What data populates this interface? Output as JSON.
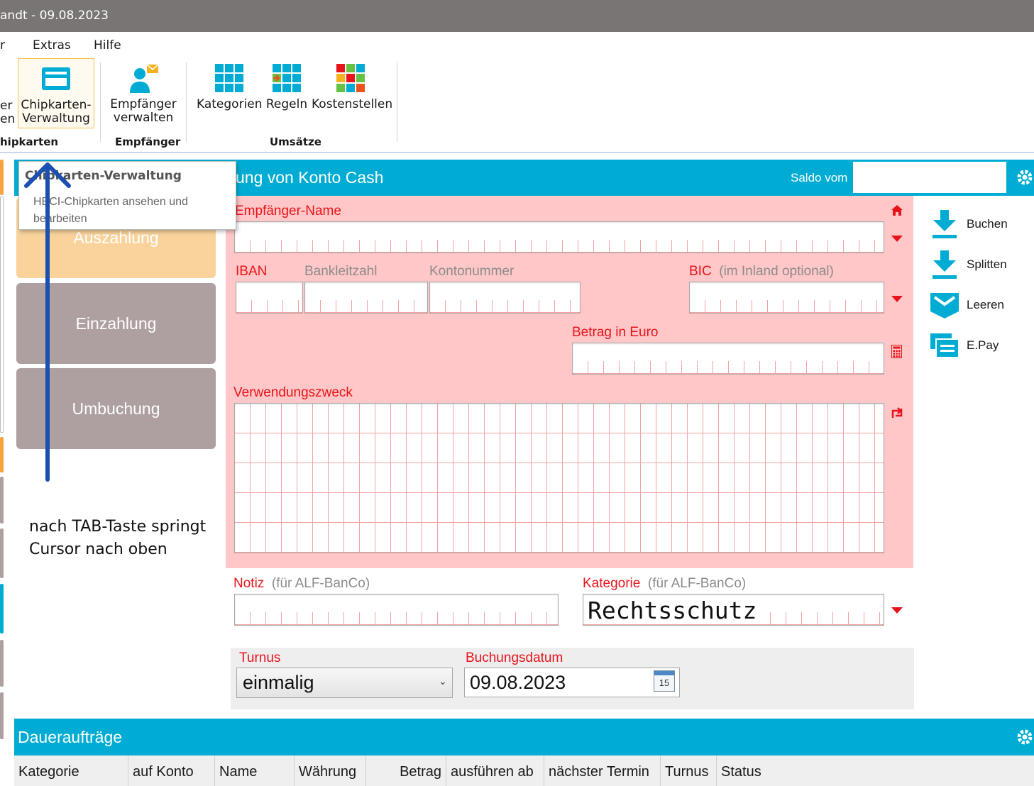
{
  "window": {
    "title": "andt  -  09.08.2023"
  },
  "menu": {
    "items": [
      {
        "label": "r"
      },
      {
        "label": "Extras"
      },
      {
        "label": "Hilfe"
      }
    ]
  },
  "ribbon": {
    "partial_button": {
      "line1": "er",
      "line2": "en"
    },
    "chip_button": {
      "line1": "Chipkarten-",
      "line2": "Verwaltung",
      "icon": "card-icon"
    },
    "chip_group": "hipkarten",
    "empf_button": {
      "line1": "Empfänger",
      "line2": "verwalten",
      "icon": "person-mail-icon"
    },
    "empf_group": "Empfänger",
    "umsaetze_buttons": [
      {
        "label": "Kategorien",
        "icon": "grid-icon"
      },
      {
        "label": "Regeln",
        "icon": "grid-arrow-icon"
      },
      {
        "label": "Kostenstellen",
        "icon": "grid-color-icon"
      }
    ],
    "umsaetze_group": "Umsätze"
  },
  "tooltip": {
    "title": "Chipkarten-Verwaltung",
    "text": "HBCI-Chipkarten ansehen und bearbeiten"
  },
  "form_header": {
    "title": "ung von Konto Cash",
    "saldo_label": "Saldo vom"
  },
  "tiles": [
    {
      "label": "Auszahlung"
    },
    {
      "label": "Einzahlung"
    },
    {
      "label": "Umbuchung"
    }
  ],
  "form": {
    "empfaenger_label": "Empfänger-Name",
    "iban_label": "IBAN",
    "blz_label": "Bankleitzahl",
    "kontonummer_label": "Kontonummer",
    "bic_label": "BIC",
    "bic_hint": "(im Inland optional)",
    "betrag_label": "Betrag in Euro",
    "verwendungszweck_label": "Verwendungszweck",
    "notiz_label": "Notiz",
    "notiz_hint": "(für ALF-BanCo)",
    "kategorie_label": "Kategorie",
    "kategorie_hint": "(für ALF-BanCo)",
    "kategorie_value": "Rechtsschutz",
    "turnus_label": "Turnus",
    "turnus_value": "einmalig",
    "buchungsdatum_label": "Buchungsdatum",
    "buchungsdatum_value": "09.08.2023",
    "calendar_day": "15"
  },
  "actions": [
    {
      "label": "Buchen",
      "icon": "download-icon"
    },
    {
      "label": "Splitten",
      "icon": "download-icon"
    },
    {
      "label": "Leeren",
      "icon": "envelope-icon"
    },
    {
      "label": "E.Pay",
      "icon": "epay-icon"
    }
  ],
  "annotation": {
    "line1": "nach TAB-Taste springt",
    "line2": "Cursor nach oben"
  },
  "dauerauftraege": {
    "title": "Daueraufträge",
    "columns": [
      "Kategorie",
      "auf Konto",
      "Name",
      "Währung",
      "Betrag",
      "ausführen ab",
      "nächster Termin",
      "Turnus",
      "Status"
    ]
  },
  "colors": {
    "accent": "#00acd3",
    "form_bg": "#ffc7c7",
    "label_red": "#e8141b",
    "tile_orange": "#f9d39b",
    "tile_grey": "#ae9fa0",
    "annotation_arrow": "#1b4fb0"
  }
}
